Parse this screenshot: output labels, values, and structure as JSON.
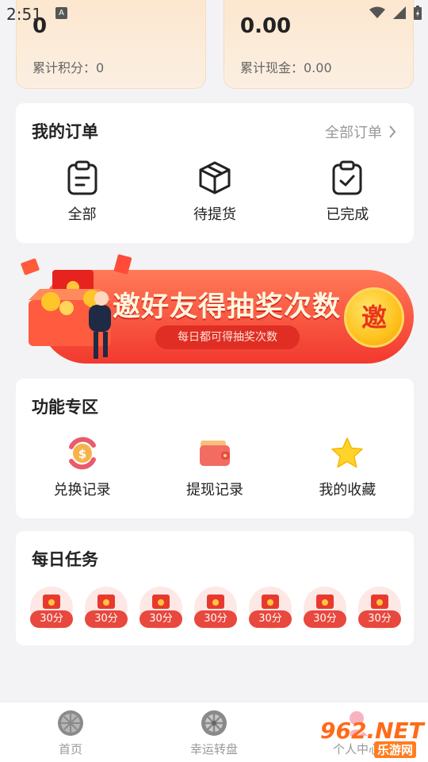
{
  "status_bar": {
    "time": "2:51",
    "notification_icon": "A"
  },
  "points": {
    "left": {
      "value": "0",
      "label": "累计积分：0"
    },
    "right": {
      "value": "0.00",
      "label": "累计现金：0.00"
    }
  },
  "orders": {
    "title": "我的订单",
    "all_link": "全部订单",
    "items": [
      {
        "label": "全部",
        "icon": "clipboard-icon"
      },
      {
        "label": "待提货",
        "icon": "package-icon"
      },
      {
        "label": "已完成",
        "icon": "clipboard-check-icon"
      }
    ]
  },
  "banner": {
    "title": "邀好友得抽奖次数",
    "subtitle": "每日都可得抽奖次数",
    "coin_text": "邀"
  },
  "functions": {
    "title": "功能专区",
    "items": [
      {
        "label": "兑换记录",
        "icon": "coin-exchange-icon"
      },
      {
        "label": "提现记录",
        "icon": "wallet-icon"
      },
      {
        "label": "我的收藏",
        "icon": "star-icon"
      }
    ]
  },
  "tasks": {
    "title": "每日任务",
    "items": [
      "30分",
      "30分",
      "30分",
      "30分",
      "30分",
      "30分",
      "30分"
    ]
  },
  "bottom_nav": {
    "items": [
      {
        "label": "首页",
        "icon": "home-icon"
      },
      {
        "label": "幸运转盘",
        "icon": "wheel-icon"
      },
      {
        "label": "个人中心",
        "icon": "profile-icon"
      }
    ]
  },
  "watermark": {
    "big": "962.NET",
    "small": "乐游网"
  },
  "colors": {
    "accent": "#f2392e",
    "card_bg": "#ffffff",
    "page_bg": "#f3f3f6"
  }
}
